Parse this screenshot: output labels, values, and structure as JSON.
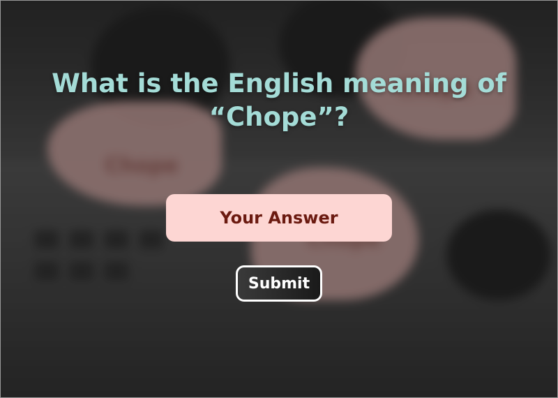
{
  "quiz": {
    "question": "What is the English meaning of “Chope”?",
    "answer_placeholder": "Your Answer",
    "answer_value": "",
    "submit_label": "Submit"
  },
  "background": {
    "bubble_texts": [
      "Chope",
      "Chope",
      "Chope"
    ]
  },
  "colors": {
    "question_text": "#a4dcd7",
    "answer_field_bg": "#fdd6d3",
    "answer_text": "#6b1a10",
    "submit_border": "#ffffff",
    "bubble": "#c9a09c"
  }
}
